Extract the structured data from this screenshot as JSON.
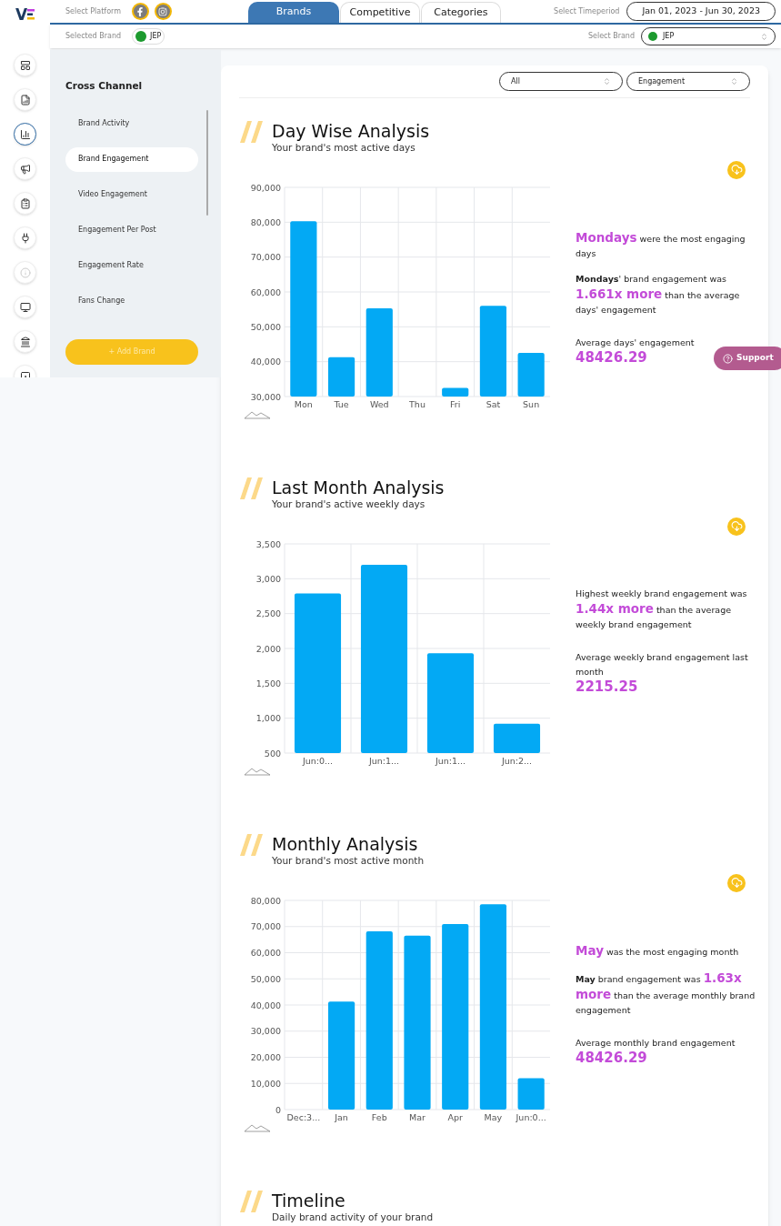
{
  "header": {
    "logo": "V",
    "platform_label": "Select Platform",
    "platforms": [
      {
        "kind": "facebook",
        "selected": true
      },
      {
        "kind": "instagram",
        "selected": true
      }
    ],
    "tabs": [
      {
        "label": "Brands",
        "selected": true
      },
      {
        "label": "Competitive",
        "selected": false
      },
      {
        "label": "Categories",
        "selected": false
      }
    ],
    "timeperiod_label": "Select Timeperiod",
    "timeperiod": "Jan 01, 2023 - Jun 30, 2023",
    "selected_brand_label": "Selected Brand",
    "selected_brand": "JEP",
    "select_brand_label": "Select Brand",
    "select_brand": "JEP"
  },
  "rail": [
    {
      "kind": "layout",
      "selected": false
    },
    {
      "kind": "report",
      "selected": false
    },
    {
      "kind": "chart",
      "selected": true
    },
    {
      "kind": "megaphone",
      "selected": false
    },
    {
      "kind": "clipboard",
      "selected": false
    },
    {
      "kind": "plug",
      "selected": false
    },
    {
      "kind": "info",
      "selected": false
    },
    {
      "kind": "monitor",
      "selected": false
    },
    {
      "kind": "bank",
      "selected": false
    },
    {
      "kind": "frame",
      "selected": false
    }
  ],
  "sidebar": {
    "title": "Cross Channel",
    "items": [
      {
        "label": "Brand Activity",
        "selected": false
      },
      {
        "label": "Brand Engagement",
        "selected": true
      },
      {
        "label": "Video Engagement",
        "selected": false
      },
      {
        "label": "Engagement Per Post",
        "selected": false
      },
      {
        "label": "Engagement Rate",
        "selected": false
      },
      {
        "label": "Fans Change",
        "selected": false
      }
    ],
    "add_button": "+ Add Brand"
  },
  "filters": [
    {
      "value": "All"
    },
    {
      "value": "Engagement"
    }
  ],
  "sections": [
    {
      "title": "Day Wise Analysis",
      "subtitle": "Your brand's most active days",
      "chart_data": {
        "type": "bar",
        "categories": [
          "Mon",
          "Tue",
          "Wed",
          "Thu",
          "Fri",
          "Sat",
          "Sun"
        ],
        "series": [
          {
            "color": "#03a9f4",
            "values": [
              80300,
              41300,
              55300,
              null,
              32500,
              56000,
              42500
            ]
          }
        ],
        "ylim": [
          30000,
          90000
        ],
        "grid": true,
        "yticks": [
          {
            "value": 30000,
            "label": "30,000"
          },
          {
            "value": 40000,
            "label": "40,000"
          },
          {
            "value": 50000,
            "label": "50,000"
          },
          {
            "value": 60000,
            "label": "60,000"
          },
          {
            "value": 70000,
            "label": "70,000"
          },
          {
            "value": 80000,
            "label": "80,000"
          },
          {
            "value": 90000,
            "label": "90,000"
          }
        ]
      },
      "insights": [
        {
          "parts": [
            {
              "kind": "highlight",
              "text": "Mondays"
            },
            {
              "kind": "plain",
              "text": " were the most engaging days"
            }
          ]
        },
        {
          "parts": [
            {
              "kind": "bold",
              "text": "Mondays"
            },
            {
              "kind": "plain",
              "text": "' brand engagement was "
            },
            {
              "kind": "highlight",
              "text": "1.661x more"
            },
            {
              "kind": "plain",
              "text": " than the average days' engagement"
            }
          ]
        }
      ],
      "average_label": "Average days' engagement",
      "average": "48426.29"
    },
    {
      "title": "Last Month Analysis",
      "subtitle": "Your brand's active weekly days",
      "chart_data": {
        "type": "bar",
        "categories": [
          "Jun:0...",
          "Jun:1...",
          "Jun:1...",
          "Jun:2..."
        ],
        "series": [
          {
            "color": "#03a9f4",
            "values": [
              2790,
              3200,
              1930,
              920
            ]
          }
        ],
        "ylim": [
          500,
          3500
        ],
        "grid": true,
        "yticks": [
          {
            "value": 500,
            "label": "500"
          },
          {
            "value": 1000,
            "label": "1,000"
          },
          {
            "value": 1500,
            "label": "1,500"
          },
          {
            "value": 2000,
            "label": "2,000"
          },
          {
            "value": 2500,
            "label": "2,500"
          },
          {
            "value": 3000,
            "label": "3,000"
          },
          {
            "value": 3500,
            "label": "3,500"
          }
        ]
      },
      "insights": [
        {
          "parts": [
            {
              "kind": "plain",
              "text": "Highest weekly brand engagement was "
            },
            {
              "kind": "highlight",
              "text": "1.44x more"
            },
            {
              "kind": "plain",
              "text": " than the average weekly brand engagement"
            }
          ]
        }
      ],
      "average_label": "Average weekly brand engagement last month",
      "average": "2215.25"
    },
    {
      "title": "Monthly Analysis",
      "subtitle": "Your brand's most active month",
      "chart_data": {
        "type": "bar",
        "categories": [
          "Dec:3...",
          "Jan",
          "Feb",
          "Mar",
          "Apr",
          "May",
          "Jun:0..."
        ],
        "series": [
          {
            "color": "#03a9f4",
            "values": [
              null,
              41300,
              68200,
              66500,
              71000,
              78500,
              12000
            ]
          }
        ],
        "ylim": [
          0,
          80000
        ],
        "grid": true,
        "yticks": [
          {
            "value": 0,
            "label": "0"
          },
          {
            "value": 10000,
            "label": "10,000"
          },
          {
            "value": 20000,
            "label": "20,000"
          },
          {
            "value": 30000,
            "label": "30,000"
          },
          {
            "value": 40000,
            "label": "40,000"
          },
          {
            "value": 50000,
            "label": "50,000"
          },
          {
            "value": 60000,
            "label": "60,000"
          },
          {
            "value": 70000,
            "label": "70,000"
          },
          {
            "value": 80000,
            "label": "80,000"
          }
        ]
      },
      "insights": [
        {
          "parts": [
            {
              "kind": "highlight",
              "text": "May"
            },
            {
              "kind": "plain",
              "text": " was the most engaging month"
            }
          ]
        },
        {
          "parts": [
            {
              "kind": "bold",
              "text": "May"
            },
            {
              "kind": "plain",
              "text": " brand engagement was "
            },
            {
              "kind": "highlight",
              "text": "1.63x more"
            },
            {
              "kind": "plain",
              "text": " than the average monthly brand engagement"
            }
          ]
        }
      ],
      "average_label": "Average monthly brand engagement",
      "average": "48426.29"
    }
  ],
  "timeline": {
    "title": "Timeline",
    "subtitle": "Daily brand activity of your brand"
  },
  "support_button": "Support"
}
